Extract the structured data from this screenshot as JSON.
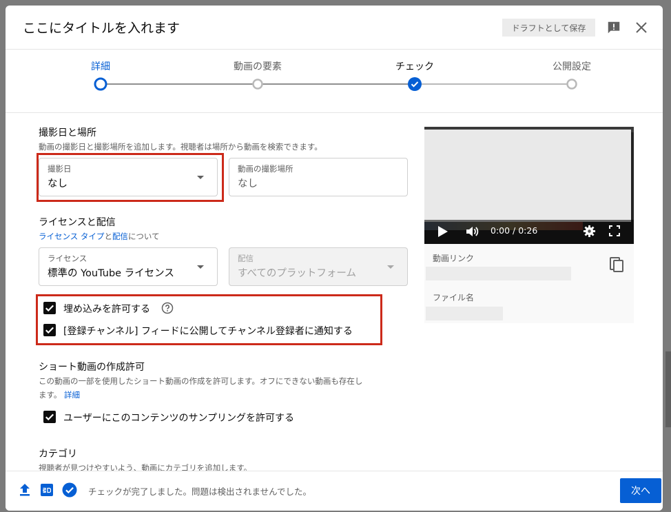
{
  "dialog": {
    "title": "ここにタイトルを入れます",
    "draft_label": "ドラフトとして保存"
  },
  "stepper": {
    "steps": [
      {
        "label": "詳細",
        "state": "active"
      },
      {
        "label": "動画の要素",
        "state": "pending"
      },
      {
        "label": "チェック",
        "state": "done"
      },
      {
        "label": "公開設定",
        "state": "pending"
      }
    ]
  },
  "recording": {
    "title": "撮影日と場所",
    "subtitle": "動画の撮影日と撮影場所を追加します。視聴者は場所から動画を検索できます。",
    "date": {
      "label": "撮影日",
      "value": "なし"
    },
    "location": {
      "label": "動画の撮影場所",
      "placeholder": "なし"
    }
  },
  "license": {
    "title": "ライセンスと配信",
    "help_link1": "ライセンス タイプ",
    "help_mid": "と",
    "help_link2": "配信",
    "help_end": "について",
    "license_field": {
      "label": "ライセンス",
      "value": "標準の YouTube ライセンス"
    },
    "distribution_field": {
      "label": "配信",
      "value": "すべてのプラットフォーム"
    }
  },
  "options": {
    "embed_label": "埋め込みを許可する",
    "notify_label": "[登録チャンネル] フィードに公開してチャンネル登録者に通知する"
  },
  "shorts": {
    "title": "ショート動画の作成許可",
    "desc_line1": "この動画の一部を使用したショート動画の作成を許可します。オフにできない動画も存在し",
    "desc_line2": "ます。",
    "desc_link": "詳細",
    "sampling_label": "ユーザーにこのコンテンツのサンプリングを許可する"
  },
  "category": {
    "title": "カテゴリ",
    "subtitle": "視聴者が見つけやすいよう、動画にカテゴリを追加します。"
  },
  "preview": {
    "time": "0:00 / 0:26",
    "video_link_label": "動画リンク",
    "file_name_label": "ファイル名"
  },
  "footer": {
    "status": "チェックが完了しました。問題は検出されませんでした。",
    "next_label": "次へ"
  },
  "colors": {
    "accent": "#065fd4",
    "highlight": "#cc2a1a"
  }
}
